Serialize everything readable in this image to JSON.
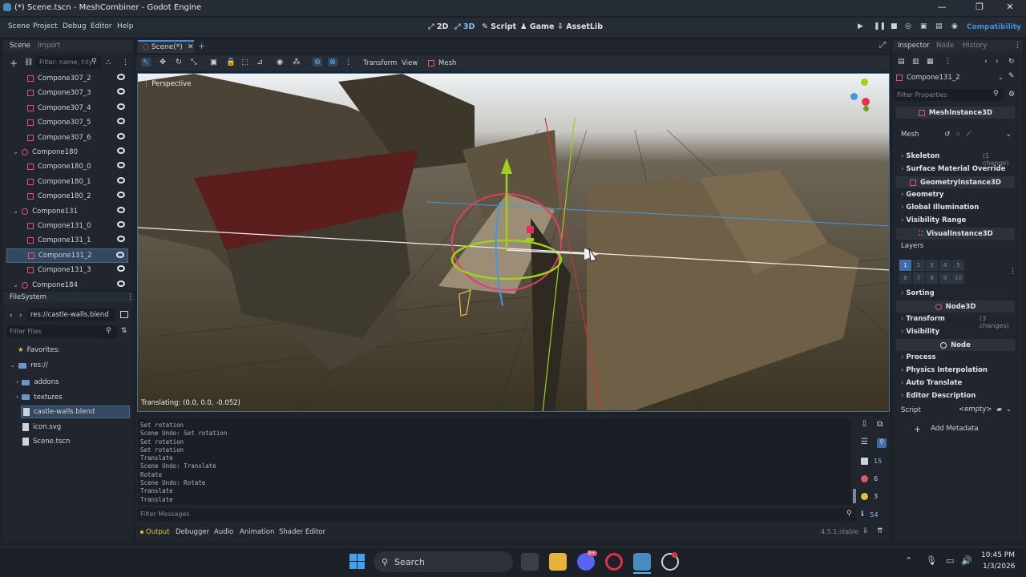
{
  "window": {
    "title": "(*) Scene.tscn - MeshCombiner - Godot Engine"
  },
  "menu": {
    "items": [
      "Scene",
      "Project",
      "Debug",
      "Editor",
      "Help"
    ]
  },
  "modes": {
    "d2": "2D",
    "d3": "3D",
    "script": "Script",
    "game": "Game",
    "assetlib": "AssetLib"
  },
  "renderer": "Compatibility",
  "scene_dock": {
    "tabs": [
      "Scene",
      "Import"
    ],
    "filter_placeholder": "Filter: name, t:ty",
    "nodes": [
      {
        "name": "Compone307_2",
        "kind": "mesh",
        "indent": 1
      },
      {
        "name": "Compone307_3",
        "kind": "mesh",
        "indent": 1
      },
      {
        "name": "Compone307_4",
        "kind": "mesh",
        "indent": 1
      },
      {
        "name": "Compone307_5",
        "kind": "mesh",
        "indent": 1
      },
      {
        "name": "Compone307_6",
        "kind": "mesh",
        "indent": 1
      },
      {
        "name": "Compone180",
        "kind": "node",
        "indent": 0
      },
      {
        "name": "Compone180_0",
        "kind": "mesh",
        "indent": 1
      },
      {
        "name": "Compone180_1",
        "kind": "mesh",
        "indent": 1
      },
      {
        "name": "Compone180_2",
        "kind": "mesh",
        "indent": 1
      },
      {
        "name": "Compone131",
        "kind": "node",
        "indent": 0
      },
      {
        "name": "Compone131_0",
        "kind": "mesh",
        "indent": 1
      },
      {
        "name": "Compone131_1",
        "kind": "mesh",
        "indent": 1
      },
      {
        "name": "Compone131_2",
        "kind": "mesh",
        "indent": 1,
        "selected": true
      },
      {
        "name": "Compone131_3",
        "kind": "mesh",
        "indent": 1
      },
      {
        "name": "Compone184",
        "kind": "node",
        "indent": 0
      }
    ]
  },
  "filesystem": {
    "title": "FileSystem",
    "path": "res://castle-walls.blend",
    "filter_placeholder": "Filter Files",
    "favorites": "Favorites:",
    "root": "res://",
    "items": [
      {
        "name": "addons",
        "kind": "folder"
      },
      {
        "name": "textures",
        "kind": "folder"
      },
      {
        "name": "castle-walls.blend",
        "kind": "file",
        "selected": true
      },
      {
        "name": "icon.svg",
        "kind": "file"
      },
      {
        "name": "Scene.tscn",
        "kind": "file"
      }
    ]
  },
  "editor_tab": {
    "label": "Scene(*)"
  },
  "toolbar": {
    "transform": "Transform",
    "view": "View",
    "mesh": "Mesh"
  },
  "viewport": {
    "perspective": "Perspective",
    "status": "Translating: (0.0, 0.0, -0.052)"
  },
  "console": {
    "lines": [
      "Set rotation",
      "Scene Undo: Set rotation",
      "Set rotation",
      "Set rotation",
      "Translate",
      "Scene Undo: Translate",
      "Rotate",
      "Scene Undo: Rotate",
      "Translate",
      "Translate"
    ],
    "filter_placeholder": "Filter Messages",
    "counts": {
      "messages": "15",
      "errors": "6",
      "warnings": "3",
      "info": "54"
    }
  },
  "bottom_tabs": [
    "Output",
    "Debugger",
    "Audio",
    "Animation",
    "Shader Editor"
  ],
  "version": "4.5.1.stable",
  "inspector": {
    "tabs": [
      "Inspector",
      "Node",
      "History"
    ],
    "object": "Compone131_2",
    "filter_placeholder": "Filter Properties",
    "class_mesh": "MeshInstance3D",
    "mesh_label": "Mesh",
    "skeleton": "Skeleton",
    "skeleton_note": "(1 change)",
    "surface_override": "Surface Material Override",
    "class_geometry": "GeometryInstance3D",
    "geometry": "Geometry",
    "gi": "Global Illumination",
    "vis_range": "Visibility Range",
    "class_visual": "VisualInstance3D",
    "layers": "Layers",
    "layer_cells": [
      "1",
      "2",
      "3",
      "4",
      "5",
      "6",
      "7",
      "8",
      "9",
      "10"
    ],
    "sorting": "Sorting",
    "class_node3d": "Node3D",
    "transform": "Transform",
    "transform_note": "(3 changes)",
    "visibility": "Visibility",
    "class_node": "Node",
    "process": "Process",
    "physics_interp": "Physics Interpolation",
    "auto_translate": "Auto Translate",
    "editor_desc": "Editor Description",
    "script": "Script",
    "script_value": "<empty>",
    "add_metadata": "Add Metadata"
  },
  "taskbar": {
    "search": "Search",
    "time": "10:45 PM",
    "date": "1/3/2026",
    "discord_badge": "9+"
  },
  "colors": {
    "accent": "#4a8bd6",
    "selection": "#34495f",
    "error": "#e0566a",
    "warning": "#e0c23c"
  }
}
